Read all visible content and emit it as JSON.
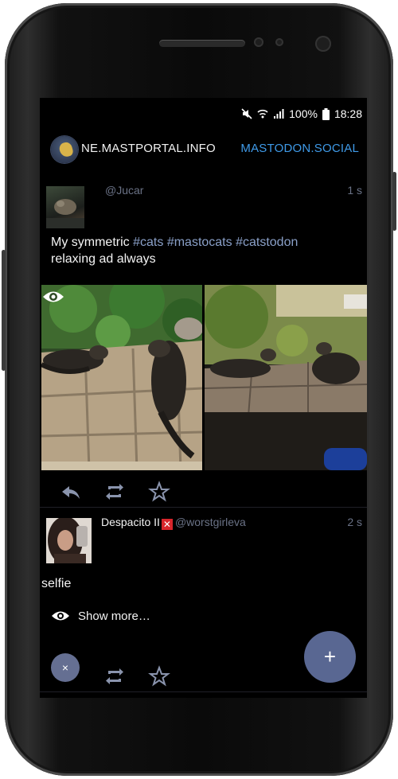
{
  "status_bar": {
    "battery": "100%",
    "time": "18:28",
    "icons": [
      "mute-icon",
      "wifi-icon",
      "signal-icon",
      "battery-icon"
    ]
  },
  "app_bar": {
    "instance_title": "NE.MASTPORTAL.INFO",
    "other_instance": "MASTODON.SOCIAL"
  },
  "posts": [
    {
      "handle": "@Jucar",
      "time": "1 s",
      "content_plain": "My symmetric ",
      "tags": [
        "#cats",
        "#mastocats",
        "#catstodon"
      ],
      "content_end": "relaxing ad always",
      "media_count": 2
    },
    {
      "display_name": "Despacito II",
      "handle": "@worstgirleva",
      "time": "2 s",
      "content": "selfie",
      "show_more": "Show more…"
    }
  ],
  "fab": {
    "label": "+"
  },
  "notification_bubble": {
    "label": "×"
  },
  "colors": {
    "background": "#000000",
    "accent_link": "#3f9ae8",
    "fab": "#596792",
    "meta_text": "#6a7286",
    "hashtag": "#8aa0c8"
  }
}
